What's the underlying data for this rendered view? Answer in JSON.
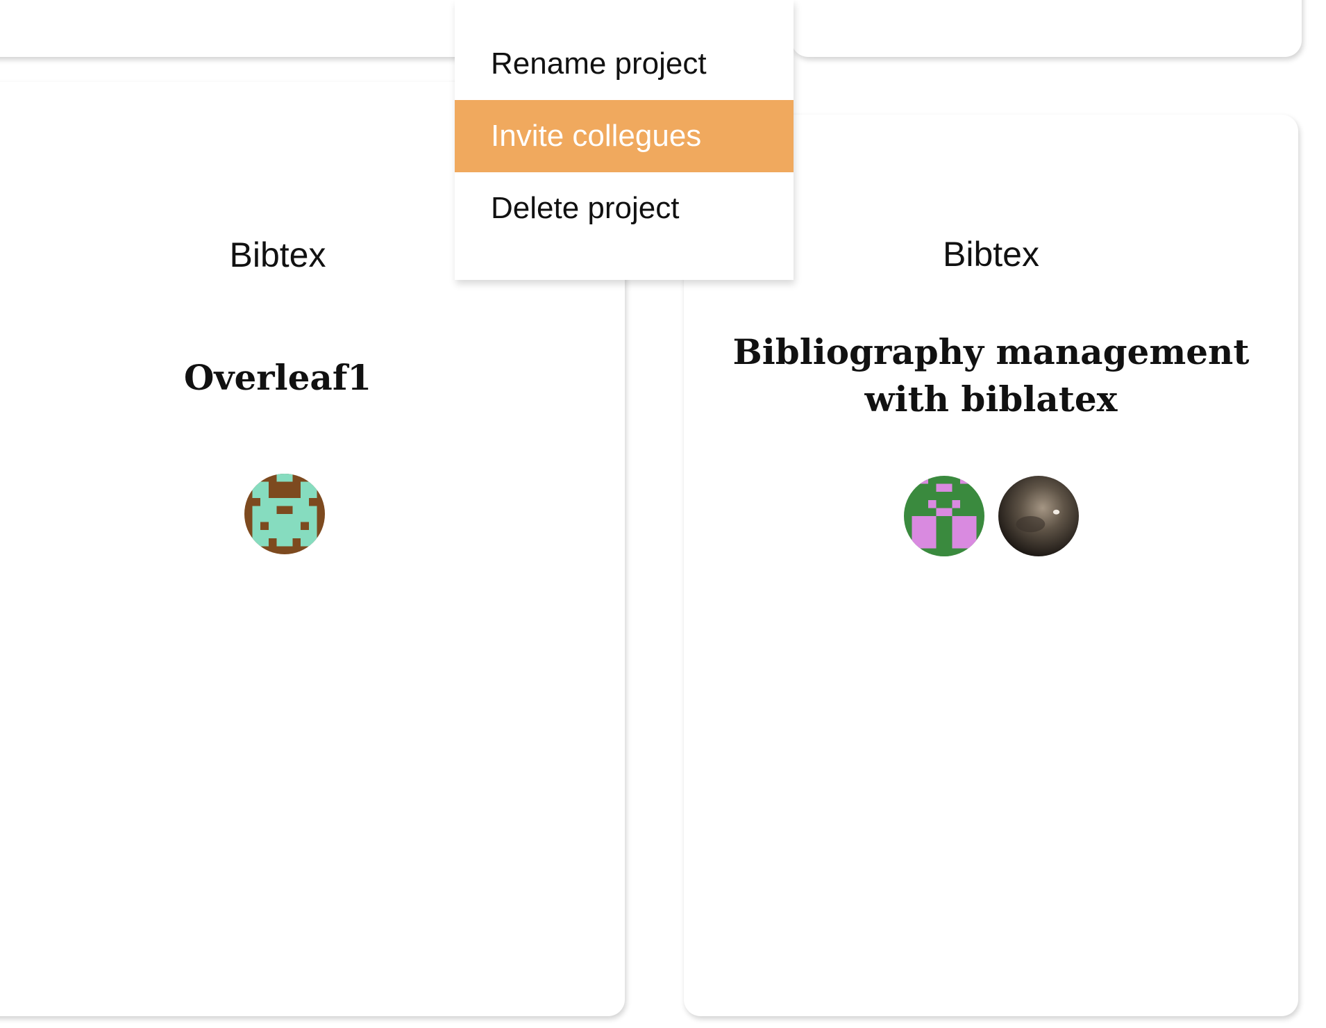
{
  "menu": {
    "items": [
      {
        "label": "Rename project",
        "highlighted": false
      },
      {
        "label": "Invite collegues",
        "highlighted": true
      },
      {
        "label": "Delete project",
        "highlighted": false
      }
    ],
    "highlight_color": "#f0a95e"
  },
  "cards": [
    {
      "category": "Bibtex",
      "title": "Overleaf1",
      "avatars": [
        "pixel-avatar-brown-mint"
      ]
    },
    {
      "category": "Bibtex",
      "title_line1": "Bibliography management",
      "title_line2": "with biblatex",
      "avatars": [
        "pixel-avatar-green-pink",
        "photo-avatar-dark"
      ]
    }
  ]
}
